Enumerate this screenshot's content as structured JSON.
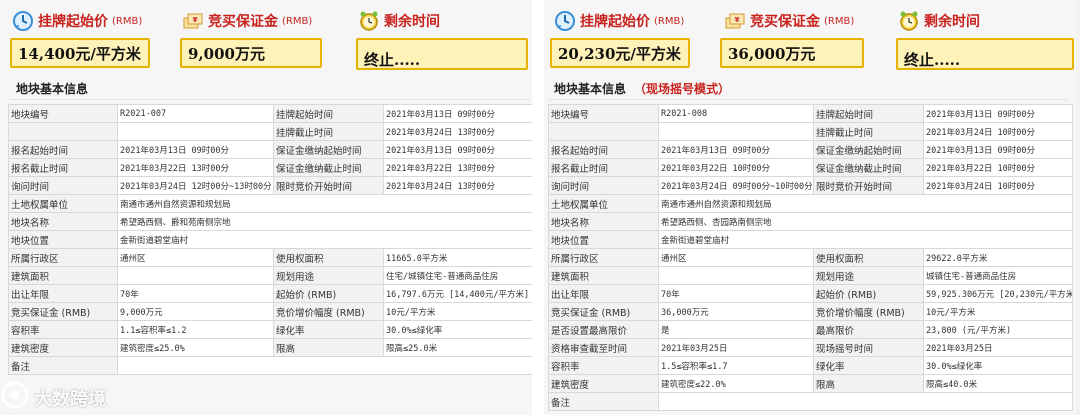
{
  "left": {
    "headers": {
      "start_price_label": "挂牌起始价",
      "deposit_label": "竞买保证金",
      "remaining_label": "剩余时间",
      "rmb": "(RMB)"
    },
    "values": {
      "start_price": "14,400元/平方米",
      "deposit": "9,000万元",
      "remaining": "终止....."
    },
    "section_title": "地块基本信息",
    "mode": "",
    "rows": [
      [
        "地块编号",
        "R2021-007",
        "挂牌起始时间",
        "2021年03月13日 09时00分"
      ],
      [
        "",
        "",
        "挂牌截止时间",
        "2021年03月24日 13时00分"
      ],
      [
        "报名起始时间",
        "2021年03月13日 09时00分",
        "保证金缴纳起始时间",
        "2021年03月13日 09时00分"
      ],
      [
        "报名截止时间",
        "2021年03月22日 13时00分",
        "保证金缴纳截止时间",
        "2021年03月22日 13时00分"
      ],
      [
        "询问时间",
        "2021年03月24日 12时00分~13时00分",
        "限时竞价开始时间",
        "2021年03月24日 13时00分"
      ],
      [
        "土地权属单位",
        "南通市通州自然资源和规划局",
        "",
        ""
      ],
      [
        "地块名称",
        "希望路西侧、爵和苑南侧宗地",
        "",
        ""
      ],
      [
        "地块位置",
        "金新街道碧堂庙村",
        "",
        ""
      ],
      [
        "所属行政区",
        "通州区",
        "使用权面积",
        "11665.0平方米"
      ],
      [
        "建筑面积",
        "",
        "规划用途",
        "住宅/城镇住宅-普通商品住房"
      ],
      [
        "出让年限",
        "70年",
        "起始价 (RMB)",
        "16,797.6万元 [14,400元/平方米]"
      ],
      [
        "竞买保证金 (RMB)",
        "9,000万元",
        "竞价增价幅度 (RMB)",
        "10元/平方米"
      ],
      [
        "容积率",
        "1.1≤容积率≤1.2",
        "绿化率",
        "30.0%≤绿化率"
      ],
      [
        "建筑密度",
        "建筑密度≤25.0%",
        "限高",
        "限高≤25.0米"
      ],
      [
        "备注",
        "",
        "",
        ""
      ]
    ]
  },
  "right": {
    "headers": {
      "start_price_label": "挂牌起始价",
      "deposit_label": "竞买保证金",
      "remaining_label": "剩余时间",
      "rmb": "(RMB)"
    },
    "values": {
      "start_price": "20,230元/平方米",
      "deposit": "36,000万元",
      "remaining": "终止....."
    },
    "section_title": "地块基本信息",
    "mode": "（现场摇号模式）",
    "rows": [
      [
        "地块编号",
        "R2021-008",
        "挂牌起始时间",
        "2021年03月13日 09时00分"
      ],
      [
        "",
        "",
        "挂牌截止时间",
        "2021年03月24日 10时00分"
      ],
      [
        "报名起始时间",
        "2021年03月13日 09时00分",
        "保证金缴纳起始时间",
        "2021年03月13日 09时00分"
      ],
      [
        "报名截止时间",
        "2021年03月22日 10时00分",
        "保证金缴纳截止时间",
        "2021年03月22日 10时00分"
      ],
      [
        "询问时间",
        "2021年03月24日 09时00分~10时00分",
        "限时竞价开始时间",
        "2021年03月24日 10时00分"
      ],
      [
        "土地权属单位",
        "南通市通州自然资源和规划局",
        "",
        ""
      ],
      [
        "地块名称",
        "希望路西侧、杏园路南侧宗地",
        "",
        ""
      ],
      [
        "地块位置",
        "金新街道碧堂庙村",
        "",
        ""
      ],
      [
        "所属行政区",
        "通州区",
        "使用权面积",
        "29622.0平方米"
      ],
      [
        "建筑面积",
        "",
        "规划用途",
        "城镇住宅-普通商品住房"
      ],
      [
        "出让年限",
        "70年",
        "起始价 (RMB)",
        "59,925.306万元 [20,230元/平方米]"
      ],
      [
        "竞买保证金 (RMB)",
        "36,000万元",
        "竞价增价幅度 (RMB)",
        "10元/平方米"
      ],
      [
        "是否设置最高限价",
        "是",
        "最高限价",
        "23,800 (元/平方米)"
      ],
      [
        "资格审查截至时间",
        "2021年03月25日",
        "现场摇号时间",
        "2021年03月25日"
      ],
      [
        "容积率",
        "1.5≤容积率≤1.7",
        "绿化率",
        "30.0%≤绿化率"
      ],
      [
        "建筑密度",
        "建筑密度≤22.0%",
        "限高",
        "限高≤40.0米"
      ],
      [
        "备注",
        "",
        "",
        ""
      ]
    ]
  },
  "watermark": "大数跨境",
  "icons": {
    "price": "clock-arrow-icon",
    "deposit": "money-icon",
    "timer": "alarm-clock-icon"
  },
  "colors": {
    "accent_red": "#c8231f",
    "box_fill": "#fff2b8",
    "box_border": "#e6b400"
  }
}
